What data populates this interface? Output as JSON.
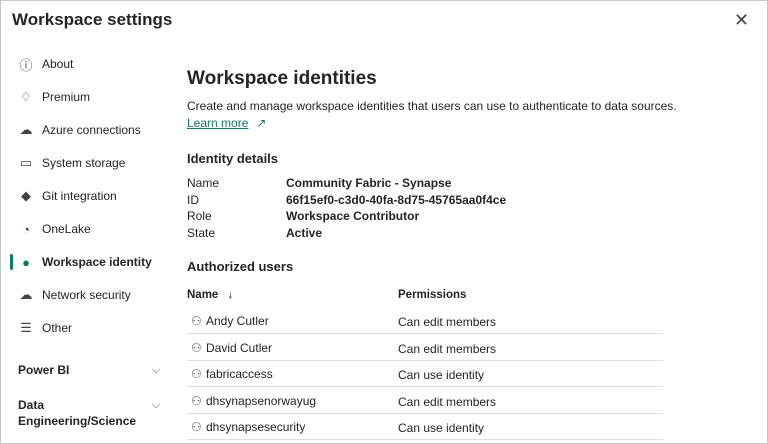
{
  "title": "Workspace settings",
  "close_icon": "close-icon",
  "nav": [
    {
      "label": "About",
      "icon": "info-icon",
      "glyph": "ⓘ"
    },
    {
      "label": "Premium",
      "icon": "diamond-icon",
      "glyph": "♢"
    },
    {
      "label": "Azure connections",
      "icon": "cloud-link-icon",
      "glyph": "☁"
    },
    {
      "label": "System storage",
      "icon": "storage-icon",
      "glyph": "▭"
    },
    {
      "label": "Git integration",
      "icon": "git-icon",
      "glyph": "◆"
    },
    {
      "label": "OneLake",
      "icon": "onelake-icon",
      "glyph": "◔"
    },
    {
      "label": "Workspace identity",
      "icon": "person-icon",
      "glyph": "●"
    },
    {
      "label": "Network security",
      "icon": "cloud-shield-icon",
      "glyph": "☁"
    },
    {
      "label": "Other",
      "icon": "list-icon",
      "glyph": "☰"
    }
  ],
  "groups": [
    {
      "label": "Power BI"
    },
    {
      "label": "Data Engineering/Science"
    }
  ],
  "main": {
    "heading": "Workspace identities",
    "description": "Create and manage workspace identities that users can use to authenticate to data sources.",
    "learn_more": "Learn more",
    "identity_heading": "Identity details",
    "details": [
      {
        "key": "Name",
        "value": "Community Fabric - Synapse"
      },
      {
        "key": "ID",
        "value": "66f15ef0-c3d0-40fa-8d75-45765aa0f4ce"
      },
      {
        "key": "Role",
        "value": "Workspace Contributor"
      },
      {
        "key": "State",
        "value": "Active"
      }
    ],
    "users_heading": "Authorized users",
    "columns": {
      "name": "Name",
      "sort": "↓",
      "permissions": "Permissions"
    },
    "users": [
      {
        "name": "Andy Cutler",
        "permission": "Can edit members"
      },
      {
        "name": "David Cutler",
        "permission": "Can edit members"
      },
      {
        "name": "fabricaccess",
        "permission": "Can use identity"
      },
      {
        "name": "dhsynapsenorwayug",
        "permission": "Can edit members"
      },
      {
        "name": "dhsynapsesecurity",
        "permission": "Can use identity"
      }
    ]
  },
  "accent": "#117865"
}
